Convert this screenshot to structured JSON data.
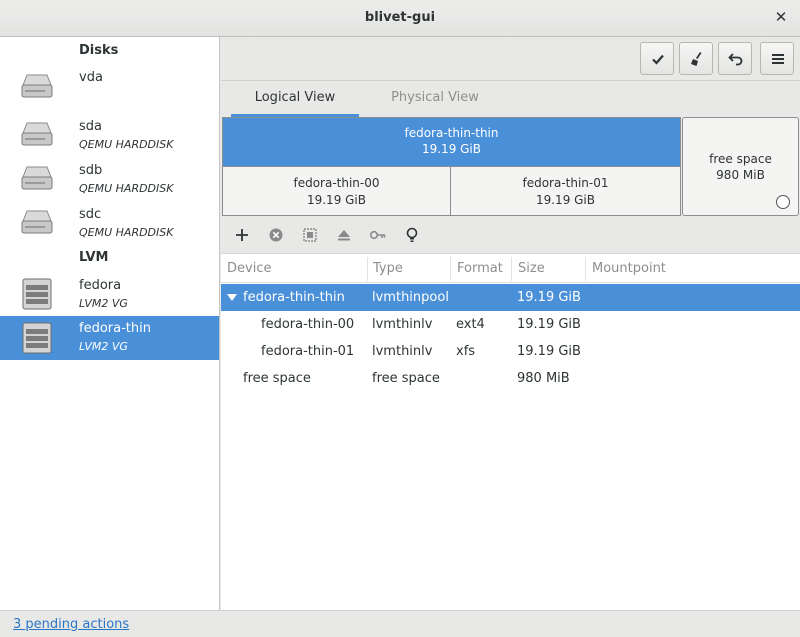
{
  "window": {
    "title": "blivet-gui",
    "close_label": "✕"
  },
  "sidebar": {
    "disks_header": "Disks",
    "lvm_header": "LVM",
    "items": [
      {
        "name": "vda",
        "sub": "",
        "icon": "harddisk-icon"
      },
      {
        "name": "sda",
        "sub": "QEMU HARDDISK",
        "icon": "harddisk-icon"
      },
      {
        "name": "sdb",
        "sub": "QEMU HARDDISK",
        "icon": "harddisk-icon"
      },
      {
        "name": "sdc",
        "sub": "QEMU HARDDISK",
        "icon": "harddisk-icon"
      },
      {
        "name": "fedora",
        "sub": "LVM2 VG",
        "icon": "volume-group-icon"
      },
      {
        "name": "fedora-thin",
        "sub": "LVM2 VG",
        "icon": "volume-group-icon",
        "selected": true
      }
    ]
  },
  "toolbar": {
    "buttons": [
      "apply-icon",
      "clear-icon",
      "undo-icon",
      "menu-icon"
    ]
  },
  "tabs": [
    {
      "label": "Logical View",
      "active": true
    },
    {
      "label": "Physical View",
      "active": false
    }
  ],
  "visualization": {
    "pool": {
      "name": "fedora-thin-thin",
      "size": "19.19 GiB"
    },
    "children": [
      {
        "name": "fedora-thin-00",
        "size": "19.19 GiB"
      },
      {
        "name": "fedora-thin-01",
        "size": "19.19 GiB"
      }
    ],
    "free": {
      "name": "free space",
      "size": "980 MiB"
    }
  },
  "device_tools": [
    "add-icon",
    "delete-icon",
    "resize-icon",
    "unmount-icon",
    "decrypt-key-icon",
    "info-bulb-icon"
  ],
  "table": {
    "columns": [
      "Device",
      "Type",
      "Format",
      "Size",
      "Mountpoint"
    ],
    "rows": [
      {
        "device": "fedora-thin-thin",
        "type": "lvmthinpool",
        "format": "",
        "size": "19.19 GiB",
        "mountpoint": "",
        "selected": true,
        "expanded": true
      },
      {
        "device": "fedora-thin-00",
        "type": "lvmthinlv",
        "format": "ext4",
        "size": "19.19 GiB",
        "mountpoint": ""
      },
      {
        "device": "fedora-thin-01",
        "type": "lvmthinlv",
        "format": "xfs",
        "size": "19.19 GiB",
        "mountpoint": ""
      },
      {
        "device": "free space",
        "type": "free space",
        "format": "",
        "size": "980 MiB",
        "mountpoint": ""
      }
    ]
  },
  "status": {
    "pending_actions": "3 pending actions"
  },
  "colors": {
    "accent": "#4a90d9",
    "link": "#2a76c6"
  }
}
